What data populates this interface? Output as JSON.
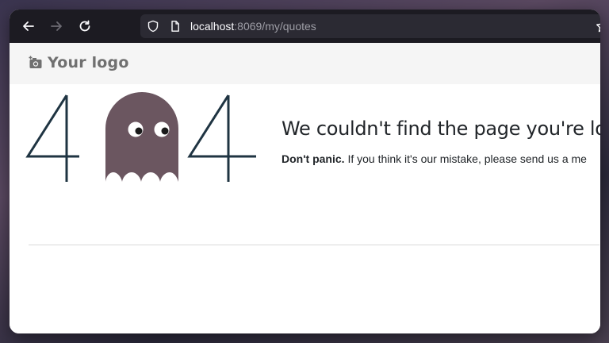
{
  "browser": {
    "back_icon": "arrow-left-icon",
    "forward_icon": "arrow-right-icon",
    "reload_icon": "reload-icon",
    "shield_icon": "shield-icon",
    "page_icon": "page-icon",
    "bookmark_icon": "star-icon",
    "url_host": "localhost",
    "url_rest": ":8069/my/quotes"
  },
  "header": {
    "logo_icon": "camera-plus-icon",
    "logo_text": "Your logo"
  },
  "error": {
    "code_digits": [
      "4",
      "4"
    ],
    "ghost_icon": "ghost-icon",
    "heading": "We couldn't find the page you're lo",
    "sub_bold": "Don't panic.",
    "sub_text": " If you think it's our mistake, please send us a me"
  },
  "colors": {
    "digits": "#1f3442",
    "ghost": "#6b5660",
    "toolbar": "#1c1b22",
    "header": "#f5f5f5"
  }
}
